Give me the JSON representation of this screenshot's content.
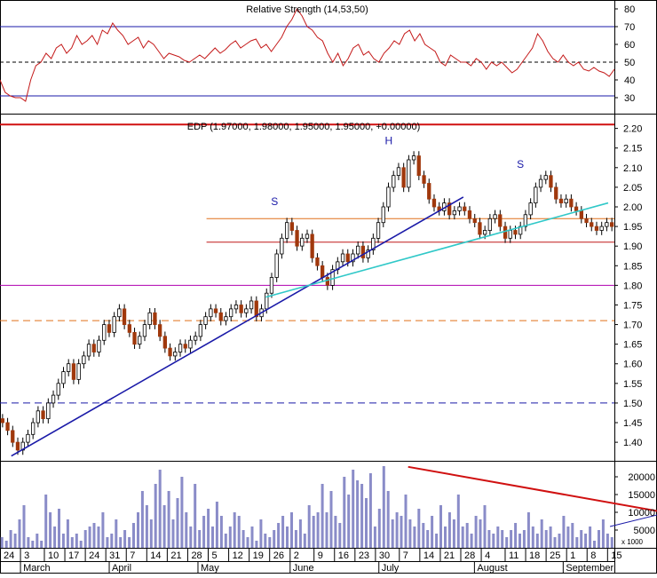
{
  "chart_data": [
    {
      "type": "line",
      "panel": "rsi",
      "title": "Relative Strength (14,53,50)",
      "y_ticks": [
        30,
        40,
        50,
        60,
        70,
        80
      ],
      "ylim": [
        24,
        84
      ],
      "reference_lines": [
        {
          "value": 70,
          "style": "solid",
          "color": "#1a1aa8"
        },
        {
          "value": 50,
          "style": "dashed",
          "color": "#000000"
        },
        {
          "value": 31,
          "style": "solid",
          "color": "#1a1aa8"
        }
      ],
      "series": [
        {
          "color": "#c41a1a",
          "values": [
            40,
            33,
            31,
            30,
            30,
            28,
            40,
            48,
            50,
            55,
            52,
            58,
            60,
            55,
            58,
            65,
            60,
            62,
            65,
            60,
            68,
            66,
            72,
            68,
            65,
            60,
            62,
            64,
            58,
            62,
            60,
            56,
            52,
            55,
            54,
            53,
            51,
            50,
            52,
            54,
            52,
            55,
            58,
            55,
            57,
            60,
            62,
            58,
            60,
            62,
            63,
            58,
            60,
            56,
            60,
            64,
            70,
            74,
            80,
            76,
            70,
            68,
            64,
            62,
            55,
            50,
            55,
            48,
            52,
            58,
            60,
            54,
            56,
            52,
            50,
            55,
            58,
            62,
            60,
            66,
            68,
            62,
            66,
            60,
            58,
            56,
            50,
            48,
            54,
            52,
            50,
            50,
            48,
            52,
            50,
            46,
            50,
            48,
            50,
            47,
            44,
            46,
            50,
            54,
            58,
            66,
            62,
            56,
            52,
            50,
            54,
            50,
            48,
            50,
            46,
            45,
            47,
            45,
            44,
            42,
            46
          ]
        }
      ]
    },
    {
      "type": "candlestick",
      "panel": "price",
      "title": "EDP (1.97000, 1.98000, 1.95000, 1.95000, +0.00000)",
      "y_ticks": [
        1.4,
        1.45,
        1.5,
        1.55,
        1.6,
        1.65,
        1.7,
        1.75,
        1.8,
        1.85,
        1.9,
        1.95,
        2.0,
        2.05,
        2.1,
        2.15,
        2.2
      ],
      "ylim": [
        1.355,
        2.215
      ],
      "closes": [
        1.45,
        1.43,
        1.4,
        1.38,
        1.4,
        1.42,
        1.45,
        1.48,
        1.46,
        1.5,
        1.52,
        1.55,
        1.58,
        1.6,
        1.56,
        1.6,
        1.62,
        1.65,
        1.63,
        1.66,
        1.7,
        1.68,
        1.72,
        1.74,
        1.7,
        1.68,
        1.65,
        1.67,
        1.7,
        1.73,
        1.7,
        1.67,
        1.64,
        1.62,
        1.63,
        1.65,
        1.64,
        1.66,
        1.67,
        1.7,
        1.72,
        1.74,
        1.73,
        1.71,
        1.72,
        1.74,
        1.75,
        1.73,
        1.74,
        1.76,
        1.72,
        1.74,
        1.78,
        1.82,
        1.88,
        1.92,
        1.96,
        1.94,
        1.9,
        1.92,
        1.93,
        1.87,
        1.85,
        1.82,
        1.8,
        1.84,
        1.86,
        1.88,
        1.86,
        1.88,
        1.9,
        1.87,
        1.89,
        1.92,
        1.96,
        2.0,
        2.05,
        2.08,
        2.1,
        2.05,
        2.12,
        2.13,
        2.08,
        2.06,
        2.02,
        2.0,
        1.99,
        2.01,
        1.98,
        1.99,
        2.0,
        1.99,
        1.97,
        1.96,
        1.93,
        1.94,
        1.97,
        1.98,
        1.95,
        1.92,
        1.94,
        1.93,
        1.95,
        1.98,
        2.01,
        2.05,
        2.07,
        2.08,
        2.05,
        2.02,
        2.01,
        2.02,
        2.0,
        1.99,
        1.97,
        1.96,
        1.95,
        1.94,
        1.95,
        1.96,
        1.95
      ],
      "reference_lines": [
        {
          "value": 2.21,
          "style": "solid",
          "color": "#d01010"
        },
        {
          "value": 1.97,
          "style": "solid",
          "color": "#e0701a",
          "x_from_index": 60
        },
        {
          "value": 1.91,
          "style": "solid",
          "color": "#c01818",
          "x_from_index": 60
        },
        {
          "value": 1.8,
          "style": "solid",
          "color": "#b000b0"
        },
        {
          "value": 1.71,
          "style": "dashed",
          "color": "#e0701a"
        },
        {
          "value": 1.5,
          "style": "dashed",
          "color": "#1a1aa8"
        }
      ],
      "trendlines": [
        {
          "color": "#1a1aa8",
          "from": {
            "index": 2,
            "value": 1.365
          },
          "to": {
            "index": 105,
            "value": 2.025
          }
        },
        {
          "color": "#30c8c8",
          "from": {
            "index": 60,
            "value": 1.77
          },
          "to": {
            "index": 138,
            "value": 2.01
          }
        }
      ],
      "annotations": [
        {
          "text": "S",
          "index": 62,
          "value": 2.005
        },
        {
          "text": "H",
          "index": 88,
          "value": 2.16
        },
        {
          "text": "S",
          "index": 118,
          "value": 2.1
        }
      ]
    },
    {
      "type": "bar",
      "panel": "volume",
      "y_ticks": [
        5000,
        10000,
        15000,
        20000
      ],
      "y_tick_labels": [
        "5000",
        "10000",
        "15000",
        "20000"
      ],
      "ylim": [
        0,
        24000
      ],
      "scale_label": "x 1000",
      "values": [
        3000,
        2000,
        5000,
        4000,
        8000,
        12000,
        3000,
        2000,
        4000,
        2000,
        15000,
        10000,
        6000,
        11000,
        4000,
        8000,
        3000,
        4000,
        2000,
        5000,
        6000,
        7000,
        6000,
        10000,
        3000,
        4000,
        8000,
        3000,
        5000,
        3000,
        7000,
        10000,
        16000,
        12000,
        8000,
        18000,
        22000,
        12000,
        16000,
        8000,
        14000,
        20000,
        10000,
        6000,
        18000,
        5000,
        9000,
        11000,
        6000,
        13000,
        9000,
        4000,
        6000,
        10000,
        9000,
        5000,
        3000,
        6000,
        2000,
        8000,
        4000,
        3000,
        5000,
        7000,
        9000,
        6000,
        10000,
        5000,
        8000,
        4000,
        12000,
        9000,
        10000,
        18000,
        10000,
        16000,
        9000,
        7000,
        20000,
        15000,
        22000,
        19000,
        18000,
        14000,
        21000,
        6000,
        11000,
        23000,
        16000,
        8000,
        10000,
        9000,
        15000,
        8000,
        6000,
        11000,
        7000,
        5000,
        9000,
        4000,
        12000,
        6000,
        10000,
        8000,
        15000,
        6000,
        7000,
        4000,
        9000,
        8000,
        12000,
        5000,
        4000,
        6000,
        5000,
        3000,
        5000,
        7000,
        4000,
        5000,
        10000,
        6000,
        4000,
        8000,
        5000,
        6000,
        3000,
        4000,
        9000,
        6000,
        7000,
        3000,
        5000,
        4000,
        6000,
        2000,
        5000,
        8000,
        4000,
        3000
      ],
      "trendlines": [
        {
          "color": "#d01010",
          "from": {
            "index": 93,
            "value": 22800
          },
          "to": {
            "index": 156,
            "value": 9000
          }
        },
        {
          "color": "#1a1aa8",
          "from": {
            "index": 139,
            "value": 6000
          },
          "to": {
            "index": 162,
            "value": 13000
          }
        }
      ]
    }
  ],
  "x_axis": {
    "day_labels": [
      {
        "text": "24",
        "index": 0
      },
      {
        "text": "3",
        "index": 6
      },
      {
        "text": "10",
        "index": 13
      },
      {
        "text": "17",
        "index": 19
      },
      {
        "text": "24",
        "index": 25
      },
      {
        "text": "31",
        "index": 31
      },
      {
        "text": "7",
        "index": 37
      },
      {
        "text": "14",
        "index": 43
      },
      {
        "text": "21",
        "index": 49
      },
      {
        "text": "28",
        "index": 55
      },
      {
        "text": "5",
        "index": 61
      },
      {
        "text": "12",
        "index": 67
      },
      {
        "text": "19",
        "index": 73
      },
      {
        "text": "26",
        "index": 79
      },
      {
        "text": "2",
        "index": 85
      },
      {
        "text": "9",
        "index": 92
      },
      {
        "text": "16",
        "index": 98
      },
      {
        "text": "23",
        "index": 104
      },
      {
        "text": "30",
        "index": 110
      },
      {
        "text": "7",
        "index": 117
      },
      {
        "text": "14",
        "index": 123
      },
      {
        "text": "21",
        "index": 129
      },
      {
        "text": "28",
        "index": 135
      },
      {
        "text": "4",
        "index": 141
      },
      {
        "text": "11",
        "index": 148
      },
      {
        "text": "18",
        "index": 154
      },
      {
        "text": "25",
        "index": 160
      },
      {
        "text": "1",
        "index": 166
      },
      {
        "text": "8",
        "index": 172
      },
      {
        "text": "15",
        "index": 178
      }
    ],
    "month_labels": [
      {
        "text": "March",
        "index": 6
      },
      {
        "text": "April",
        "index": 32
      },
      {
        "text": "May",
        "index": 58
      },
      {
        "text": "June",
        "index": 85
      },
      {
        "text": "July",
        "index": 111
      },
      {
        "text": "August",
        "index": 139
      },
      {
        "text": "September",
        "index": 165
      }
    ]
  },
  "colors": {
    "frame": "#000000",
    "candle_up": "#ffffff",
    "candle_down": "#a0380c",
    "wick": "#000000",
    "volume_bar": "#8a8cc8",
    "annotation": "#1a1aa8"
  }
}
